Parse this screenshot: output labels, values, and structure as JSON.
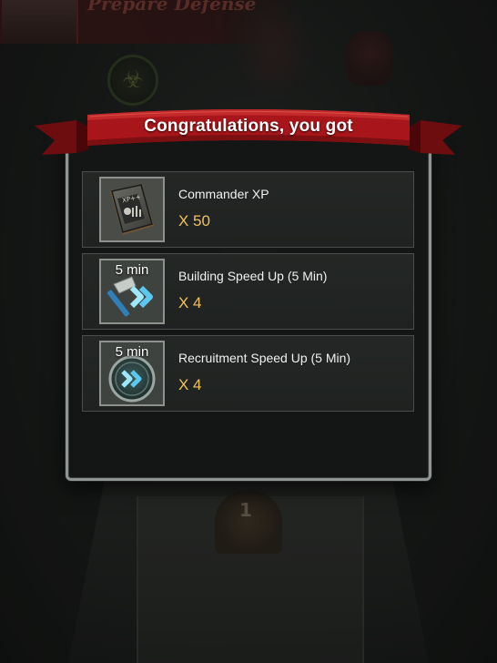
{
  "background": {
    "title": "Prepare Defense",
    "pedestal_label": "1"
  },
  "dialog": {
    "heading": "Congratulations, you got",
    "rewards": [
      {
        "name": "Commander XP",
        "quantity": "X 50",
        "icon": "commander-xp-book-icon",
        "tag": ""
      },
      {
        "name": "Building Speed Up (5 Min)",
        "quantity": "X 4",
        "icon": "building-speedup-hammer-icon",
        "tag": "5 min"
      },
      {
        "name": "Recruitment Speed Up (5 Min)",
        "quantity": "X 4",
        "icon": "recruitment-speedup-medal-icon",
        "tag": "5 min"
      }
    ]
  },
  "colors": {
    "ribbon": "#a8161b",
    "quantity": "#f1c15c",
    "frame": "#8f9691"
  }
}
